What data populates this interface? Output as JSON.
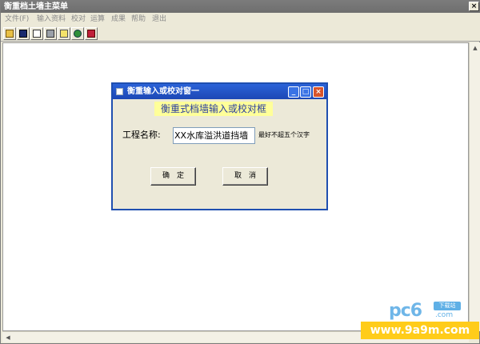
{
  "window": {
    "title": "衡重档土墙主菜单",
    "close_label": "×"
  },
  "menu": {
    "items": [
      "文件(F)",
      "输入资料",
      "校对",
      "运算",
      "成果",
      "帮助",
      "退出"
    ]
  },
  "toolbar": {
    "icons": [
      "open-icon",
      "save-icon",
      "print-preview-icon",
      "print-icon",
      "find-icon",
      "globe-icon",
      "book-icon"
    ]
  },
  "dialog": {
    "title": "衡重输入或校对窗一",
    "minimize_label": "_",
    "maximize_label": "□",
    "close_label": "×",
    "heading": "衡重式档墙输入或校对框",
    "name_label": "工程名称:",
    "name_value": "XX水库溢洪道挡墙",
    "hint": "最好不超五个汉字",
    "ok_label": "确　定",
    "cancel_label": "取　消"
  },
  "watermark": {
    "logo_text": "pc6",
    "badge_text": "下载站",
    "com_text": ".com",
    "url_text": "www.9a9m.com"
  },
  "colors": {
    "dialog_title": "#1f4fb0",
    "heading_bg": "#ffff99",
    "heading_text": "#2b3f9e",
    "watermark_url_bg": "#ffcc1a"
  }
}
